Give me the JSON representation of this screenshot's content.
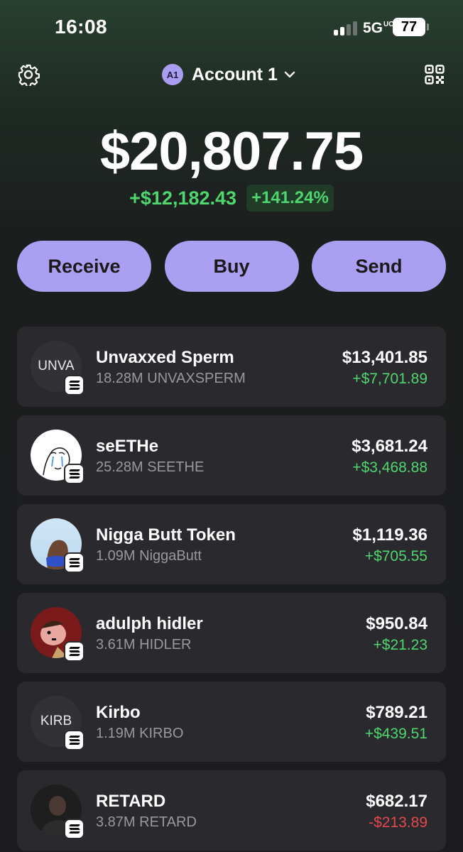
{
  "status_bar": {
    "time": "16:08",
    "network": "5G",
    "network_sub": "UC",
    "battery": "77"
  },
  "header": {
    "account_badge": "A1",
    "account_name": "Account 1",
    "icons": [
      "gear-icon",
      "chevron-down-icon",
      "qr-code-icon"
    ]
  },
  "portfolio": {
    "balance": "$20,807.75",
    "change_amount": "+$12,182.43",
    "change_percent": "+141.24%"
  },
  "actions": {
    "receive": "Receive",
    "buy": "Buy",
    "send": "Send",
    "accent_color": "#ab9ff2"
  },
  "tokens": [
    {
      "name": "Unvaxxed Sperm",
      "quantity": "18.28M UNVAXSPERM",
      "value": "$13,401.85",
      "change": "+$7,701.89",
      "direction": "up",
      "icon_text": "UNVA"
    },
    {
      "name": "seETHe",
      "quantity": "25.28M SEETHE",
      "value": "$3,681.24",
      "change": "+$3,468.88",
      "direction": "up",
      "icon_text": ""
    },
    {
      "name": "Nigga Butt Token",
      "quantity": "1.09M NiggaButt",
      "value": "$1,119.36",
      "change": "+$705.55",
      "direction": "up",
      "icon_text": ""
    },
    {
      "name": "adulph hidler",
      "quantity": "3.61M HIDLER",
      "value": "$950.84",
      "change": "+$21.23",
      "direction": "up",
      "icon_text": ""
    },
    {
      "name": "Kirbo",
      "quantity": "1.19M KIRBO",
      "value": "$789.21",
      "change": "+$439.51",
      "direction": "up",
      "icon_text": "KIRB"
    },
    {
      "name": "RETARD",
      "quantity": "3.87M RETARD",
      "value": "$682.17",
      "change": "-$213.89",
      "direction": "down",
      "icon_text": ""
    }
  ],
  "colors": {
    "positive": "#4fd66e",
    "negative": "#e5484d",
    "card": "#2a2a2e"
  }
}
